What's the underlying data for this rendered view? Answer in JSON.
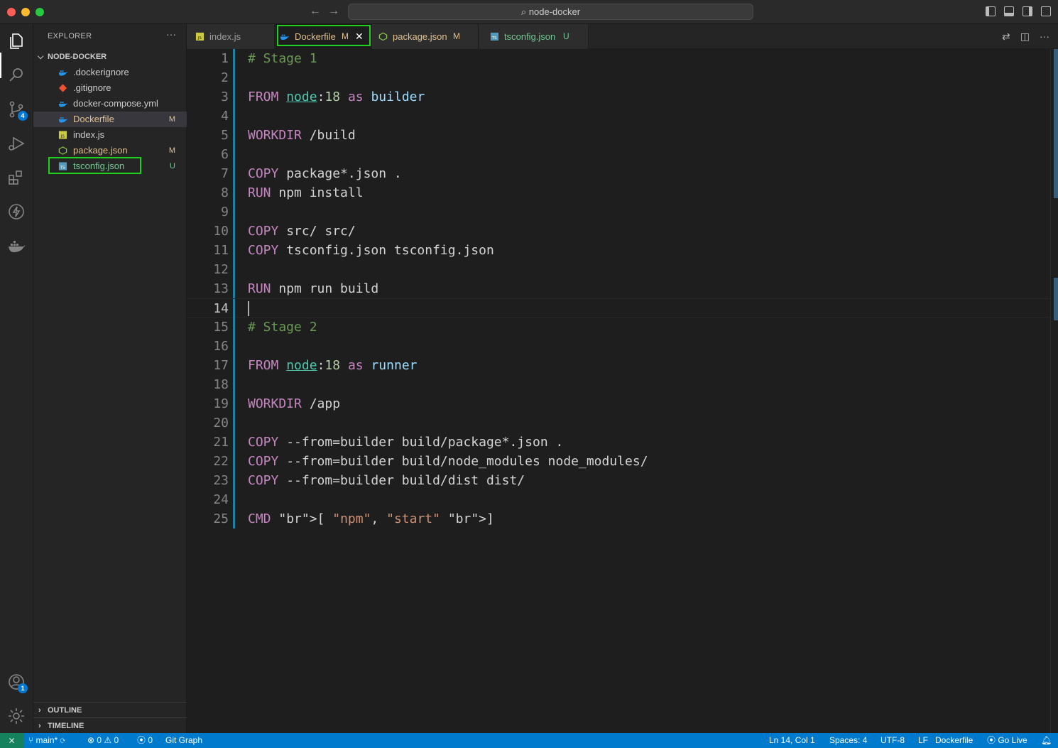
{
  "window": {
    "search_text": "node-docker"
  },
  "activity_bar": {
    "source_control_badge": "4",
    "accounts_badge": "1"
  },
  "explorer": {
    "title": "EXPLORER",
    "more": "···",
    "folder": "NODE-DOCKER",
    "files": [
      {
        "name": ".dockerignore",
        "status": "",
        "icon": "docker-icon"
      },
      {
        "name": ".gitignore",
        "status": "",
        "icon": "git-icon"
      },
      {
        "name": "docker-compose.yml",
        "status": "",
        "icon": "docker-icon"
      },
      {
        "name": "Dockerfile",
        "status": "M",
        "icon": "docker-icon"
      },
      {
        "name": "index.js",
        "status": "",
        "icon": "js-icon"
      },
      {
        "name": "package.json",
        "status": "M",
        "icon": "node-icon"
      },
      {
        "name": "tsconfig.json",
        "status": "U",
        "icon": "ts-config-icon"
      }
    ],
    "outline_label": "OUTLINE",
    "timeline_label": "TIMELINE"
  },
  "tabs": [
    {
      "label": "index.js",
      "status": "",
      "icon": "js-icon"
    },
    {
      "label": "Dockerfile",
      "status": "M",
      "icon": "docker-icon",
      "close": "✕"
    },
    {
      "label": "package.json",
      "status": "M",
      "icon": "node-icon"
    },
    {
      "label": "tsconfig.json",
      "status": "U",
      "icon": "ts-config-icon"
    }
  ],
  "editor": {
    "current_line": 14,
    "lines": [
      "# Stage 1",
      "",
      "FROM node:18 as builder",
      "",
      "WORKDIR /build",
      "",
      "COPY package*.json .",
      "RUN npm install",
      "",
      "COPY src/ src/",
      "COPY tsconfig.json tsconfig.json",
      "",
      "RUN npm run build",
      "",
      "# Stage 2",
      "",
      "FROM node:18 as runner",
      "",
      "WORKDIR /app",
      "",
      "COPY --from=builder build/package*.json .",
      "COPY --from=builder build/node_modules node_modules/",
      "COPY --from=builder build/dist dist/",
      "",
      "CMD [ \"npm\", \"start\" ]"
    ]
  },
  "status_bar": {
    "branch": "main*",
    "errors": "0",
    "warnings": "0",
    "ports": "0",
    "git_graph": "Git Graph",
    "cursor_pos": "Ln 14, Col 1",
    "spaces": "Spaces: 4",
    "encoding": "UTF-8",
    "eol": "LF",
    "language": "Dockerfile",
    "go_live": "Go Live"
  },
  "colors": {
    "accent": "#007acc",
    "highlight_box": "#1fd11f",
    "modified": "#e2c08d",
    "untracked": "#73c991"
  }
}
